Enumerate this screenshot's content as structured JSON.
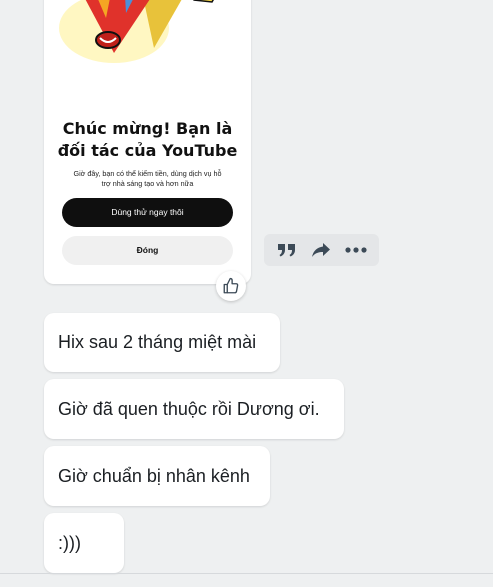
{
  "image_card": {
    "title_line1": "Chúc mừng! Bạn là",
    "title_line2": "đối tác của YouTube",
    "subtitle_line1": "Giờ đây, bạn có thể kiếm tiền, dùng dịch vụ hỗ",
    "subtitle_line2": "trợ nhà sáng tạo và hơn nữa",
    "primary_button": "Dùng thử ngay thôi",
    "secondary_button": "Đóng"
  },
  "reaction": {
    "icon": "thumbs-up-icon"
  },
  "actions": [
    {
      "icon": "quote-icon"
    },
    {
      "icon": "share-icon"
    },
    {
      "icon": "more-icon"
    }
  ],
  "messages": [
    {
      "text": "Hix sau 2 tháng miệt mài"
    },
    {
      "text": "Giờ đã quen thuộc rồi Dương ơi."
    },
    {
      "text": "Giờ chuẩn bị nhân kênh"
    },
    {
      "text": ":)))"
    }
  ],
  "colors": {
    "background": "#eef0f1",
    "bubble": "#ffffff",
    "text": "#1b1f23",
    "icon": "#3c4a57"
  }
}
